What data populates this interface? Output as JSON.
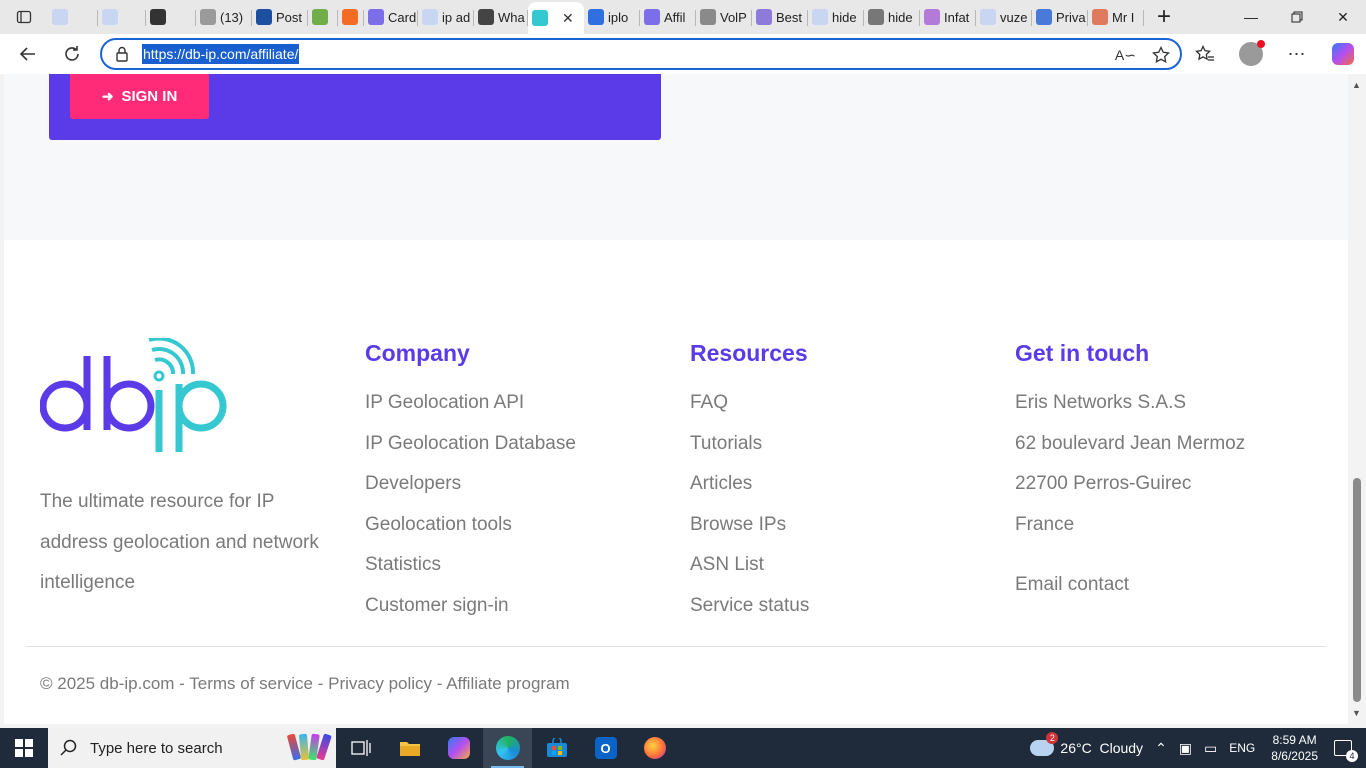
{
  "browser": {
    "tabs": [
      {
        "label": "",
        "icon": "search-icon"
      },
      {
        "label": "",
        "icon": "search-icon"
      },
      {
        "label": "",
        "icon": "openai-icon"
      },
      {
        "label": "(13)",
        "icon": "b-icon"
      },
      {
        "label": "Post",
        "icon": "xf-icon"
      },
      {
        "label": "",
        "icon": "extension-icon"
      },
      {
        "label": "",
        "icon": "brave-icon"
      },
      {
        "label": "Card",
        "icon": "circle-icon"
      },
      {
        "label": "ip ad",
        "icon": "search-icon"
      },
      {
        "label": "Wha",
        "icon": "globe-icon"
      },
      {
        "label": "",
        "icon": "dbip-icon",
        "active": true
      },
      {
        "label": "iplo",
        "icon": "dots-icon"
      },
      {
        "label": "Affil",
        "icon": "circle-icon"
      },
      {
        "label": "VolP",
        "icon": "x-icon"
      },
      {
        "label": "Best",
        "icon": "r-icon"
      },
      {
        "label": "hide",
        "icon": "search-icon"
      },
      {
        "label": "hide",
        "icon": "shield-icon"
      },
      {
        "label": "Infat",
        "icon": "dna-icon"
      },
      {
        "label": "vuze",
        "icon": "search-icon"
      },
      {
        "label": "Priva",
        "icon": "pen-icon"
      },
      {
        "label": "Mr I",
        "icon": "mk-icon"
      }
    ],
    "url": "https://db-ip.com/affiliate/"
  },
  "page": {
    "signin_label": "SIGN IN",
    "logo_text": "dbip",
    "tagline": "The ultimate resource for IP address geolocation and network intelligence",
    "company": {
      "title": "Company",
      "links": [
        "IP Geolocation API",
        "IP Geolocation Database",
        "Developers",
        "Geolocation tools",
        "Statistics",
        "Customer sign-in"
      ]
    },
    "resources": {
      "title": "Resources",
      "links": [
        "FAQ",
        "Tutorials",
        "Articles",
        "Browse IPs",
        "ASN List",
        "Service status"
      ]
    },
    "contact": {
      "title": "Get in touch",
      "lines": [
        "Eris Networks S.A.S",
        "62 boulevard Jean Mermoz",
        "22700 Perros-Guirec",
        "France"
      ],
      "email_label": "Email contact"
    },
    "footer": {
      "copyright": "© 2025 db-ip.com",
      "sep": " - ",
      "terms": "Terms of service",
      "privacy": "Privacy policy",
      "affiliate": "Affiliate program"
    }
  },
  "taskbar": {
    "search_placeholder": "Type here to search",
    "weather": "26°C  Cloudy",
    "weather_badge": "2",
    "language": "ENG",
    "time": "8:59 AM",
    "date": "8/6/2025",
    "notifications": "4"
  },
  "colors": {
    "brand_purple": "#5b3ae8",
    "brand_pink": "#ff2a78",
    "brand_teal": "#35c8d0"
  }
}
